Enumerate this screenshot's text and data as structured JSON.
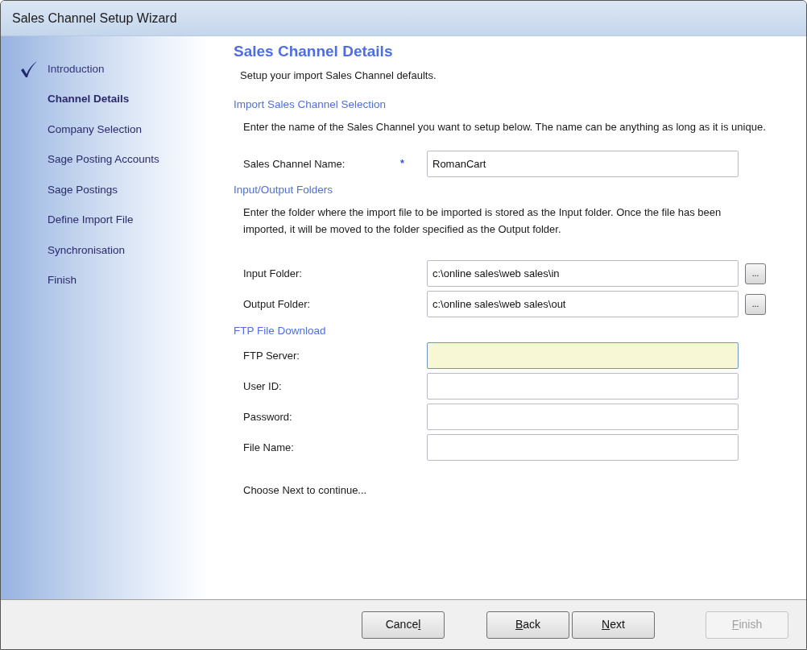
{
  "window": {
    "title": "Sales Channel Setup Wizard"
  },
  "steps": [
    {
      "label": "Introduction",
      "done": true,
      "selected": false
    },
    {
      "label": "Channel Details",
      "done": false,
      "selected": true
    },
    {
      "label": "Company Selection",
      "done": false,
      "selected": false
    },
    {
      "label": "Sage Posting Accounts",
      "done": false,
      "selected": false
    },
    {
      "label": "Sage Postings",
      "done": false,
      "selected": false
    },
    {
      "label": "Define Import File",
      "done": false,
      "selected": false
    },
    {
      "label": "Synchronisation",
      "done": false,
      "selected": false
    },
    {
      "label": "Finish",
      "done": false,
      "selected": false
    }
  ],
  "page": {
    "title": "Sales Channel Details",
    "intro": "Setup your import Sales Channel defaults.",
    "sections": [
      {
        "heading": "Import Sales Channel Selection",
        "description": "Enter the name of the Sales Channel you want to setup below.  The name can be anything as long as it is unique.",
        "fields": [
          {
            "kind": "text",
            "label": "Sales Channel Name:",
            "required": true,
            "required_mark": "*",
            "value": "RomanCart",
            "focused": false
          }
        ]
      },
      {
        "heading": "Input/Output Folders",
        "description": "Enter the folder where the import file to be imported is stored as the Input folder.  Once the file has been imported, it will be moved to the folder specified as the Output folder.",
        "fields": [
          {
            "kind": "folder",
            "label": "Input Folder:",
            "required": false,
            "value": "c:\\online sales\\web sales\\in",
            "focused": false,
            "browse": "..."
          },
          {
            "kind": "folder",
            "label": "Output Folder:",
            "required": false,
            "value": "c:\\online sales\\web sales\\out",
            "focused": false,
            "browse": "..."
          }
        ]
      },
      {
        "heading": "FTP File Download",
        "fields": [
          {
            "kind": "text",
            "label": "FTP Server:",
            "required": false,
            "focused": true
          },
          {
            "kind": "text",
            "label": "User ID:",
            "required": false,
            "focused": false
          },
          {
            "kind": "text",
            "label": "Password:",
            "required": false,
            "focused": false
          },
          {
            "kind": "text",
            "label": "File Name:",
            "required": false,
            "focused": false
          }
        ]
      }
    ],
    "footer_note": "Choose Next to continue..."
  },
  "buttons": [
    {
      "before": "Cance",
      "key": "l",
      "disabled": false
    },
    {
      "key": "B",
      "after": "ack",
      "disabled": false
    },
    {
      "key": "N",
      "after": "ext",
      "disabled": false
    },
    {
      "key": "F",
      "after": "inish",
      "disabled": true
    }
  ]
}
